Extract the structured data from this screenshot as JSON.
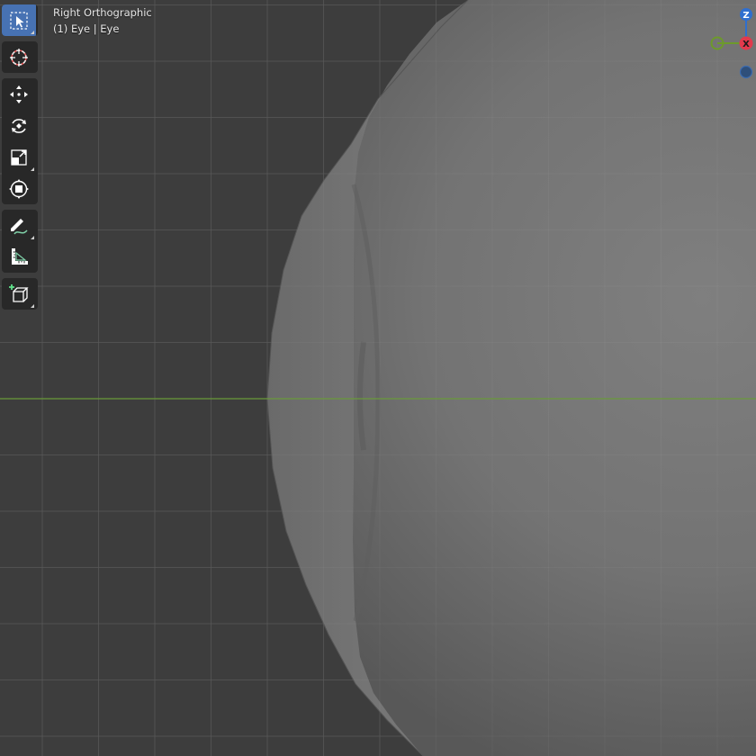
{
  "viewport": {
    "view_name": "Right Orthographic",
    "object_info": "(1) Eye | Eye",
    "background_color": "#3d3d3d",
    "grid_color": "#4a4a4a",
    "horizon_axis_color": "#6a9a3a",
    "mesh_color": "#7a7a7a"
  },
  "toolbar": {
    "active_tool": "select-box",
    "tools": [
      "select-box",
      "cursor",
      "move",
      "rotate",
      "scale",
      "transform",
      "annotate",
      "measure",
      "add-cube"
    ]
  },
  "gizmo": {
    "z_label": "Z",
    "x_label": "X",
    "z_color": "#2f6fcf",
    "x_color": "#e33a4d",
    "y_color": "#6d9a2b"
  }
}
